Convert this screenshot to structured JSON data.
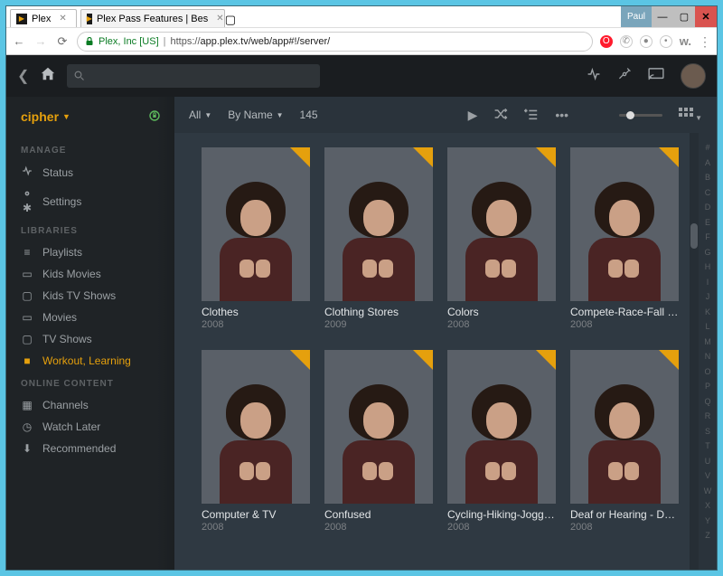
{
  "browser": {
    "tabs": [
      {
        "title": "Plex",
        "active": true
      },
      {
        "title": "Plex Pass Features | Bes",
        "active": false
      }
    ],
    "user_badge": "Paul",
    "url_host": "Plex, Inc [US]",
    "url_prefix": "https://",
    "url_path": "app.plex.tv/web/app#!/server/"
  },
  "server": {
    "name": "cipher"
  },
  "sidebar": {
    "sections": {
      "manage": {
        "label": "MANAGE",
        "items": [
          {
            "label": "Status",
            "icon": "activity"
          },
          {
            "label": "Settings",
            "icon": "gear"
          }
        ]
      },
      "libraries": {
        "label": "LIBRARIES",
        "items": [
          {
            "label": "Playlists",
            "icon": "list"
          },
          {
            "label": "Kids Movies",
            "icon": "film"
          },
          {
            "label": "Kids TV Shows",
            "icon": "tv"
          },
          {
            "label": "Movies",
            "icon": "film"
          },
          {
            "label": "TV Shows",
            "icon": "tv"
          },
          {
            "label": "Workout, Learning",
            "icon": "video",
            "active": true
          }
        ]
      },
      "online": {
        "label": "ONLINE CONTENT",
        "items": [
          {
            "label": "Channels",
            "icon": "grid"
          },
          {
            "label": "Watch Later",
            "icon": "clock"
          },
          {
            "label": "Recommended",
            "icon": "download"
          }
        ]
      }
    }
  },
  "toolbar": {
    "filter": "All",
    "sort": "By Name",
    "count": "145"
  },
  "items": [
    {
      "title": "Clothes",
      "year": "2008"
    },
    {
      "title": "Clothing Stores",
      "year": "2009"
    },
    {
      "title": "Colors",
      "year": "2008"
    },
    {
      "title": "Compete-Race-Fall B...",
      "year": "2008"
    },
    {
      "title": "Computer & TV",
      "year": "2008"
    },
    {
      "title": "Confused",
      "year": "2008"
    },
    {
      "title": "Cycling-Hiking-Jogging",
      "year": "2008"
    },
    {
      "title": "Deaf or Hearing - Do ...",
      "year": "2008"
    }
  ],
  "alpha": [
    "#",
    "A",
    "B",
    "C",
    "D",
    "E",
    "F",
    "G",
    "H",
    "I",
    "J",
    "K",
    "L",
    "M",
    "N",
    "O",
    "P",
    "Q",
    "R",
    "S",
    "T",
    "U",
    "V",
    "W",
    "X",
    "Y",
    "Z"
  ]
}
